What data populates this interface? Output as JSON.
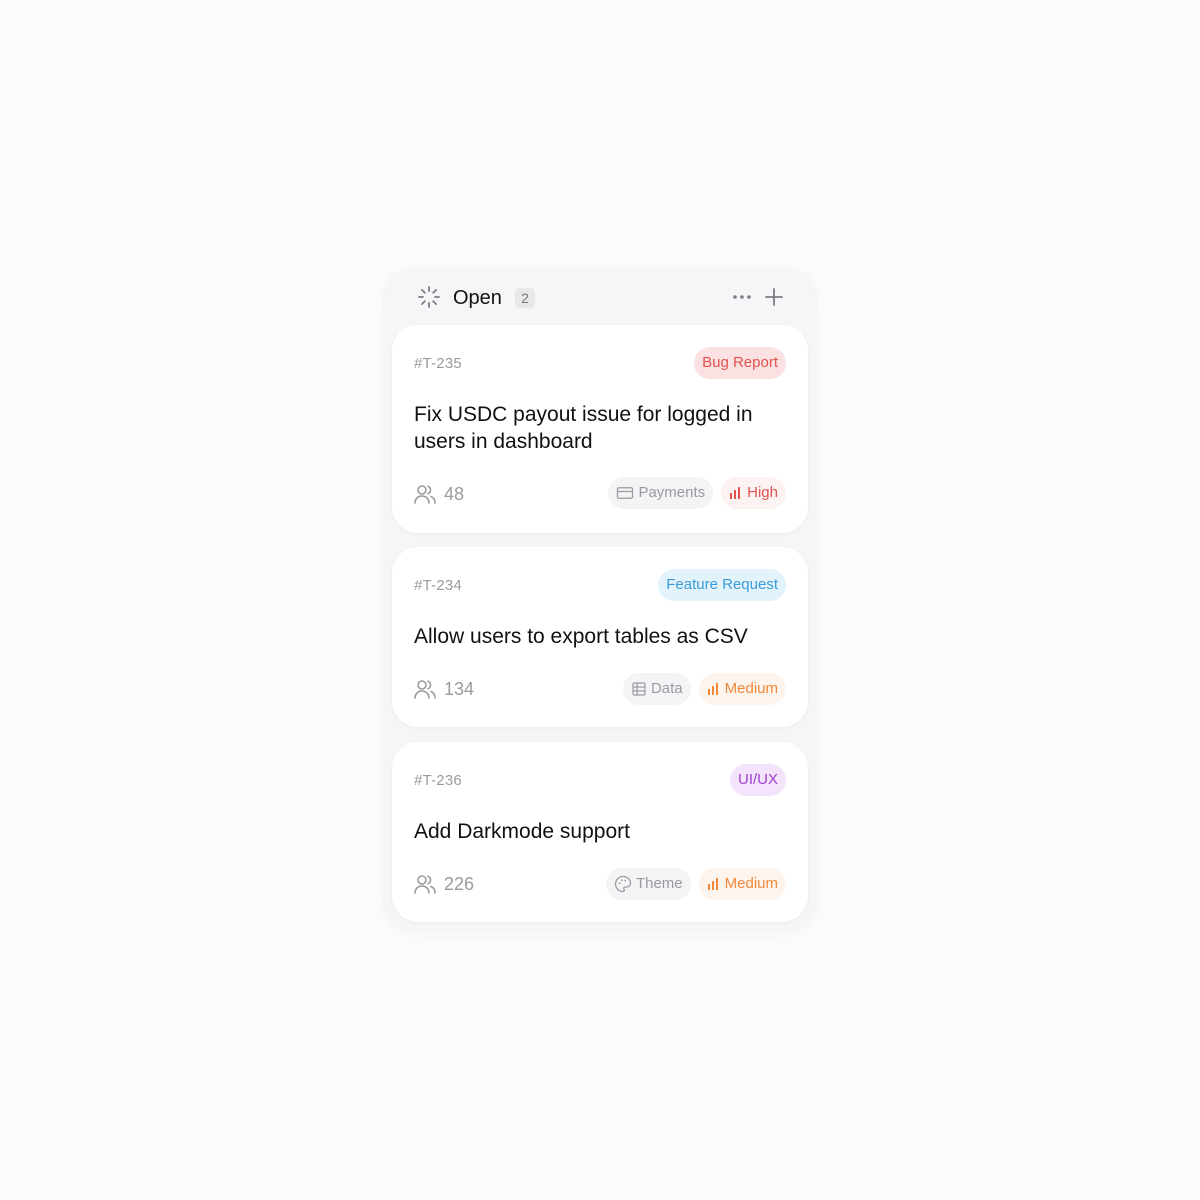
{
  "column": {
    "title": "Open",
    "count": "2",
    "status_icon": "loader-icon",
    "more_icon": "more-horizontal-icon",
    "add_icon": "plus-icon"
  },
  "cards": [
    {
      "id": "#T-235",
      "type": {
        "label": "Bug Report",
        "bg": "#fbe1e1",
        "color": "#e0534f"
      },
      "title": "Fix USDC payout issue for logged in users in dashboard",
      "assignee_count": "48",
      "category": {
        "label": "Payments",
        "icon": "credit-card-icon"
      },
      "priority": {
        "label": "High",
        "icon": "bar-chart-icon",
        "color": "#e0534f"
      }
    },
    {
      "id": "#T-234",
      "type": {
        "label": "Feature Request",
        "bg": "#e3f3fc",
        "color": "#3a9bd8"
      },
      "title": "Allow users to export tables as CSV",
      "assignee_count": "134",
      "category": {
        "label": "Data",
        "icon": "table-icon"
      },
      "priority": {
        "label": "Medium",
        "icon": "bar-chart-icon",
        "color": "#f0883a"
      }
    },
    {
      "id": "#T-236",
      "type": {
        "label": "UI/UX",
        "bg": "#f3e3fb",
        "color": "#a13fd0"
      },
      "title": "Add Darkmode support",
      "assignee_count": "226",
      "category": {
        "label": "Theme",
        "icon": "palette-icon"
      },
      "priority": {
        "label": "Medium",
        "icon": "bar-chart-icon",
        "color": "#f0883a"
      }
    }
  ]
}
